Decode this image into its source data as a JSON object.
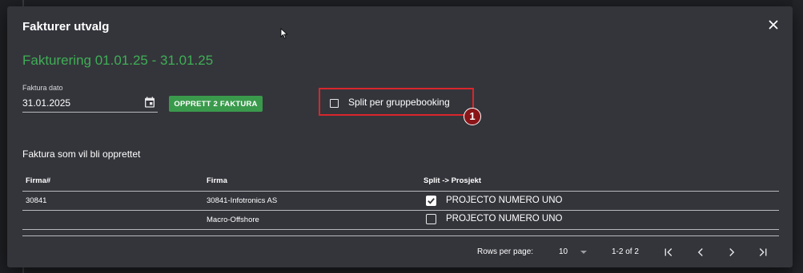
{
  "dialog": {
    "title": "Fakturer utvalg",
    "subtitle": "Fakturering 01.01.25 - 31.01.25",
    "close_icon": "close-icon"
  },
  "form": {
    "date_label": "Faktura dato",
    "date_value": "31.01.2025",
    "calendar_icon": "calendar-icon",
    "create_button_label": "OPPRETT 2 FAKTURA",
    "split_label": "Split per gruppebooking",
    "split_checked": false,
    "annotation_number": "1"
  },
  "table": {
    "section_title": "Faktura som vil bli opprettet",
    "columns": [
      "Firma#",
      "Firma",
      "Split -> Prosjekt"
    ],
    "rows": [
      {
        "firma_no": "30841",
        "firma": "30841-Infotronics AS",
        "split_checked": true,
        "project": "PROJECTO NUMERO UNO"
      },
      {
        "firma_no": "",
        "firma": "Macro-Offshore",
        "split_checked": false,
        "project": "PROJECTO NUMERO UNO"
      }
    ]
  },
  "pagination": {
    "rows_per_page_label": "Rows per page:",
    "rows_per_page_value": "10",
    "page_range": "1-2 of 2"
  },
  "colors": {
    "accent_green": "#3fae55",
    "button_green": "#3a9a4c",
    "highlight_red": "#d9262b",
    "badge_red": "#8a1518",
    "dialog_bg": "#34353b"
  }
}
